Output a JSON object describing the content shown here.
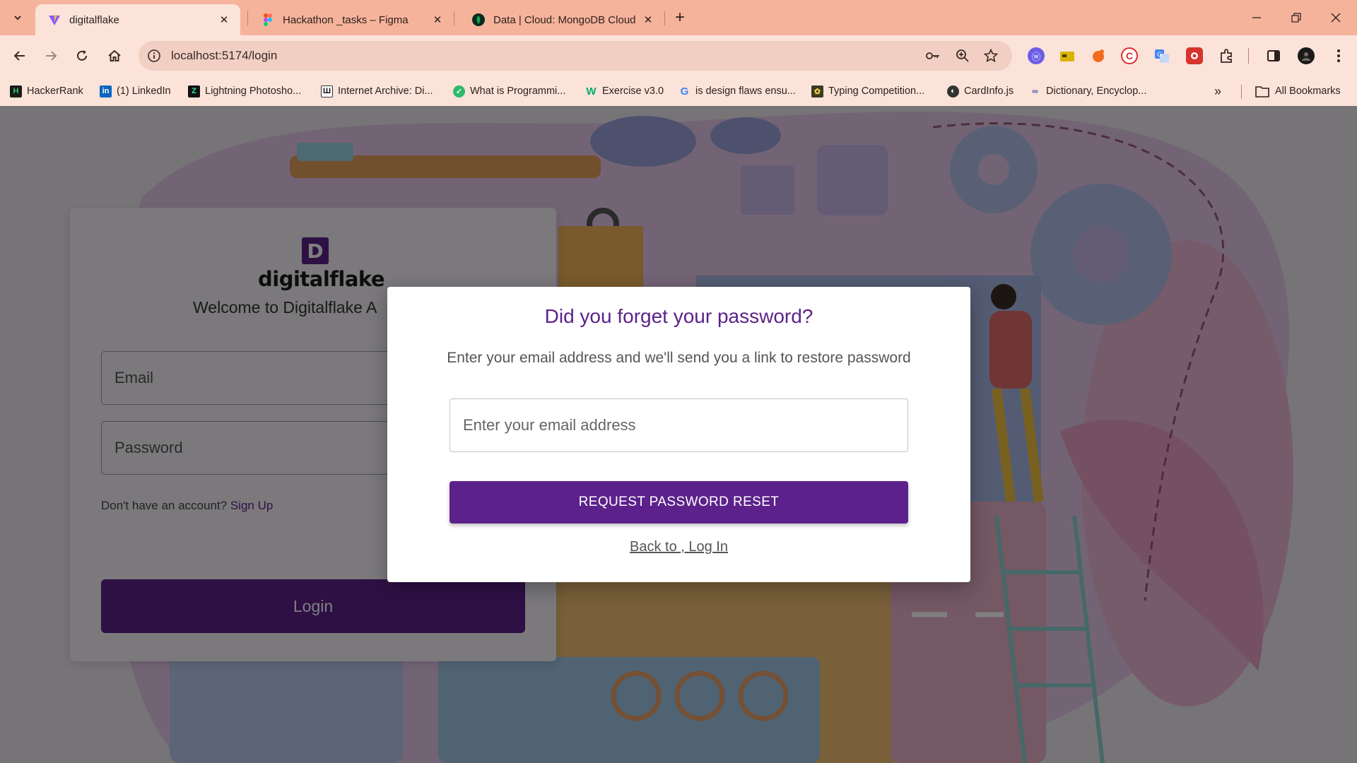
{
  "browser": {
    "tabs": [
      {
        "title": "digitalflake",
        "active": true
      },
      {
        "title": "Hackathon _tasks – Figma",
        "active": false
      },
      {
        "title": "Data | Cloud: MongoDB Cloud",
        "active": false
      }
    ],
    "new_tab_label": "+",
    "url": "localhost:5174/login",
    "bookmarks": [
      {
        "label": "HackerRank",
        "icon": "hackerrank-icon"
      },
      {
        "label": "(1) LinkedIn",
        "icon": "linkedin-icon"
      },
      {
        "label": "Lightning Photosho...",
        "icon": "lightning-icon"
      },
      {
        "label": "Internet Archive: Di...",
        "icon": "archive-icon"
      },
      {
        "label": "What is Programmi...",
        "icon": "shield-icon"
      },
      {
        "label": "Exercise v3.0",
        "icon": "w3-icon"
      },
      {
        "label": "is design flaws ensu...",
        "icon": "google-icon"
      },
      {
        "label": "Typing Competition...",
        "icon": "typing-icon"
      },
      {
        "label": "CardInfo.js",
        "icon": "globe-icon"
      },
      {
        "label": "Dictionary, Encyclop...",
        "icon": "dictionary-icon"
      }
    ],
    "all_bookmarks_label": "All Bookmarks"
  },
  "login": {
    "logo_text": "digitalflake",
    "welcome": "Welcome to Digitalflake A",
    "email_label": "Email",
    "password_label": "Password",
    "signup_prompt": "Don't have an account?",
    "signup_link": "Sign Up",
    "login_button": "Login"
  },
  "modal": {
    "title": "Did you forget your password?",
    "description": "Enter your email address and we'll send you a link to restore password",
    "email_placeholder": "Enter your email address",
    "email_value": "",
    "submit_label": "REQUEST PASSWORD RESET",
    "back_link": "Back to , Log In"
  },
  "colors": {
    "brand_purple": "#5c218a",
    "tabbar": "#f6b39b",
    "toolbar": "#fbe3da"
  }
}
